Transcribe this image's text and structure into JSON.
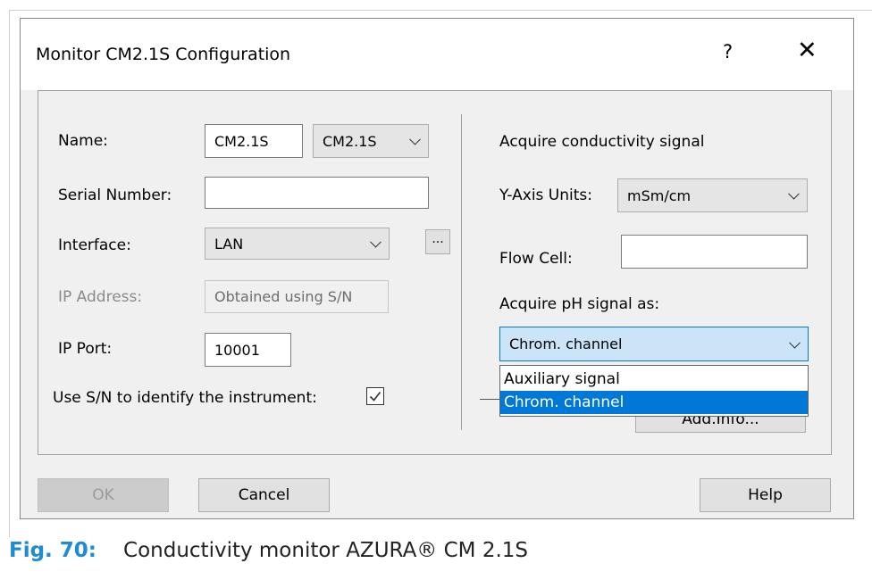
{
  "dialog": {
    "title": "Monitor CM2.1S Configuration",
    "help_glyph": "?",
    "close_glyph": "✕"
  },
  "left": {
    "name_label": "Name:",
    "name_value": "CM2.1S",
    "name_combo_value": "CM2.1S",
    "serial_label": "Serial Number:",
    "serial_value": "",
    "interface_label": "Interface:",
    "interface_value": "LAN",
    "interface_more": "...",
    "ip_address_label": "IP Address:",
    "ip_address_value": "Obtained using S/N",
    "ip_port_label": "IP Port:",
    "ip_port_value": "10001",
    "use_sn_label": "Use S/N to identify the instrument:",
    "use_sn_checked": true
  },
  "right": {
    "acquire_conductivity_label": "Acquire conductivity signal",
    "y_axis_label": "Y-Axis Units:",
    "y_axis_value": "mSm/cm",
    "flow_cell_label": "Flow Cell:",
    "flow_cell_value": "",
    "acquire_ph_label": "Acquire pH signal as:",
    "acquire_ph_value": "Chrom. channel",
    "acquire_ph_options": [
      "Auxiliary signal",
      "Chrom. channel"
    ],
    "add_info_label": "Add.Info..."
  },
  "buttons": {
    "ok": "OK",
    "cancel": "Cancel",
    "help": "Help"
  },
  "caption": {
    "fig_label": "Fig. 70:",
    "text": "Conductivity monitor AZURA® CM 2.1S"
  },
  "colors": {
    "accent": "#0078d7",
    "caption_fig": "#1f8bd1"
  }
}
